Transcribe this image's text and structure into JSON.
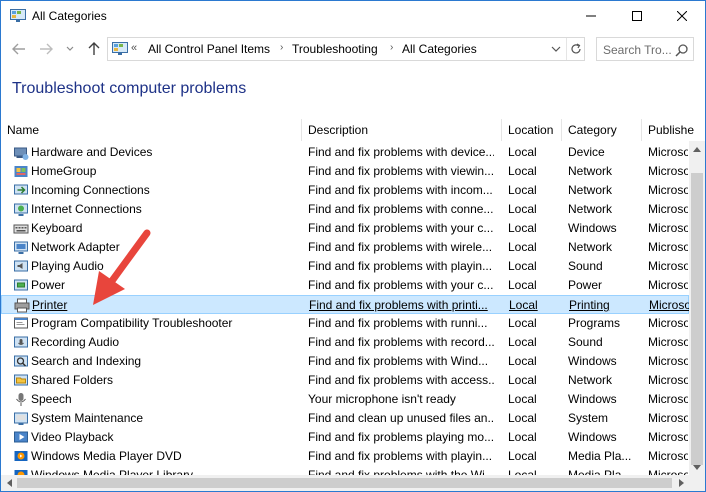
{
  "window": {
    "title": "All Categories",
    "minimize_glyph": "—",
    "maximize_glyph": "☐",
    "close_glyph": "✕"
  },
  "address_bar": {
    "overflow": "«",
    "crumbs": [
      "All Control Panel Items",
      "Troubleshooting",
      "All Categories"
    ],
    "separator": "›"
  },
  "search": {
    "placeholder": "Search Tro..."
  },
  "page_title": "Troubleshoot computer problems",
  "table": {
    "columns": [
      "Name",
      "Description",
      "Location",
      "Category",
      "Publisher"
    ],
    "column_labels_visible": [
      "Name",
      "Description",
      "Location",
      "Category",
      "Publishe"
    ],
    "rows": [
      {
        "name": "Hardware and Devices",
        "desc": "Find and fix problems with device...",
        "loc": "Local",
        "cat": "Device",
        "pub": "Microso",
        "icon": "hardware-icon"
      },
      {
        "name": "HomeGroup",
        "desc": "Find and fix problems with viewin...",
        "loc": "Local",
        "cat": "Network",
        "pub": "Microso",
        "icon": "homegroup-icon"
      },
      {
        "name": "Incoming Connections",
        "desc": "Find and fix problems with incom...",
        "loc": "Local",
        "cat": "Network",
        "pub": "Microso",
        "icon": "incoming-connections-icon"
      },
      {
        "name": "Internet Connections",
        "desc": "Find and fix problems with conne...",
        "loc": "Local",
        "cat": "Network",
        "pub": "Microso",
        "icon": "internet-connections-icon"
      },
      {
        "name": "Keyboard",
        "desc": "Find and fix problems with your c...",
        "loc": "Local",
        "cat": "Windows",
        "pub": "Microso",
        "icon": "keyboard-icon"
      },
      {
        "name": "Network Adapter",
        "desc": "Find and fix problems with wirele...",
        "loc": "Local",
        "cat": "Network",
        "pub": "Microso",
        "icon": "network-adapter-icon"
      },
      {
        "name": "Playing Audio",
        "desc": "Find and fix problems with playin...",
        "loc": "Local",
        "cat": "Sound",
        "pub": "Microso",
        "icon": "playing-audio-icon"
      },
      {
        "name": "Power",
        "desc": "Find and fix problems with your c...",
        "loc": "Local",
        "cat": "Power",
        "pub": "Microso",
        "icon": "power-icon"
      },
      {
        "name": "Printer",
        "desc": "Find and fix problems with printi...",
        "loc": "Local",
        "cat": "Printing",
        "pub": "Microso",
        "icon": "printer-icon",
        "selected": true
      },
      {
        "name": "Program Compatibility Troubleshooter",
        "desc": "Find and fix problems with runni...",
        "loc": "Local",
        "cat": "Programs",
        "pub": "Microso",
        "icon": "program-compatibility-icon"
      },
      {
        "name": "Recording Audio",
        "desc": "Find and fix problems with record...",
        "loc": "Local",
        "cat": "Sound",
        "pub": "Microso",
        "icon": "recording-audio-icon"
      },
      {
        "name": "Search and Indexing",
        "desc": "Find and fix problems with Wind...",
        "loc": "Local",
        "cat": "Windows",
        "pub": "Microso",
        "icon": "search-indexing-icon"
      },
      {
        "name": "Shared Folders",
        "desc": "Find and fix problems with access...",
        "loc": "Local",
        "cat": "Network",
        "pub": "Microso",
        "icon": "shared-folders-icon"
      },
      {
        "name": "Speech",
        "desc": "Your microphone isn't ready",
        "loc": "Local",
        "cat": "Windows",
        "pub": "Microso",
        "icon": "speech-icon"
      },
      {
        "name": "System Maintenance",
        "desc": "Find and clean up unused files an...",
        "loc": "Local",
        "cat": "System",
        "pub": "Microso",
        "icon": "system-maintenance-icon"
      },
      {
        "name": "Video Playback",
        "desc": "Find and fix problems playing mo...",
        "loc": "Local",
        "cat": "Windows",
        "pub": "Microso",
        "icon": "video-playback-icon"
      },
      {
        "name": "Windows Media Player DVD",
        "desc": "Find and fix problems with playin...",
        "loc": "Local",
        "cat": "Media Pla...",
        "pub": "Microso",
        "icon": "media-player-dvd-icon"
      },
      {
        "name": "Windows Media Player Library",
        "desc": "Find and fix problems with the Wi...",
        "loc": "Local",
        "cat": "Media Pla...",
        "pub": "Microso",
        "icon": "media-player-library-icon"
      }
    ]
  },
  "colors": {
    "title_blue": "#1e3287",
    "selection_bg": "#cce8ff",
    "selection_border": "#99d1ff",
    "annotation_red": "#e8453c"
  }
}
